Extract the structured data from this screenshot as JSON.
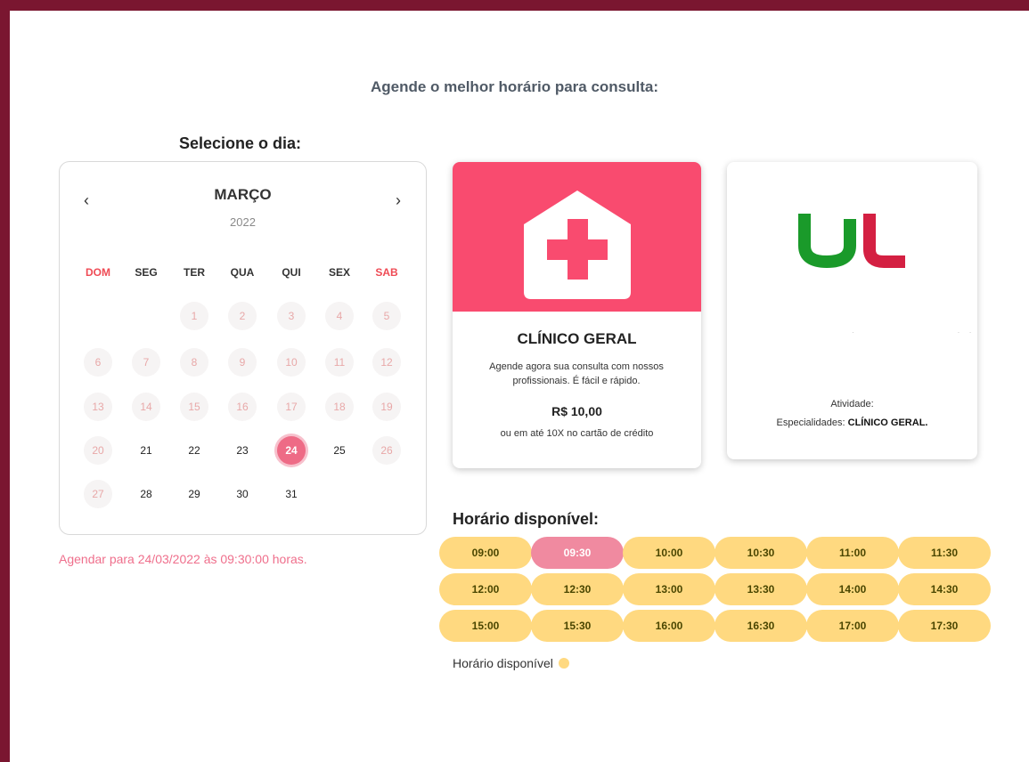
{
  "page": {
    "title": "Agende o melhor horário para consulta:"
  },
  "calendar": {
    "section_title": "Selecione o dia:",
    "month": "MARÇO",
    "year": "2022",
    "prev_icon": "chevron-left-icon",
    "next_icon": "chevron-right-icon",
    "prev_symbol": "‹",
    "next_symbol": "›",
    "weekdays": [
      "DOM",
      "SEG",
      "TER",
      "QUA",
      "QUI",
      "SEX",
      "SAB"
    ],
    "first_weekday_index": 2,
    "days_in_month": 31,
    "available_days": [
      21,
      22,
      23,
      24,
      25,
      28,
      29,
      30,
      31
    ],
    "selected_day": 24
  },
  "schedule_message": "Agendar para 24/03/2022 às 09:30:00 horas.",
  "service_card": {
    "icon": "hospital-house-icon",
    "title": "CLÍNICO GERAL",
    "description": "Agende agora sua consulta com nossos profissionais. É fácil e rápido.",
    "price": "R$ 10,00",
    "installments": "ou em até 10X no cartão de crédito"
  },
  "doctor_card": {
    "logo": "ul-logo",
    "activity": "Atividade:",
    "specialties_label": "Especialidades:",
    "specialties_value": "CLÍNICO GERAL."
  },
  "times": {
    "section_title": "Horário disponível:",
    "slots": [
      "09:00",
      "09:30",
      "10:00",
      "10:30",
      "11:00",
      "11:30",
      "12:00",
      "12:30",
      "13:00",
      "13:30",
      "14:00",
      "14:30",
      "15:00",
      "15:30",
      "16:00",
      "16:30",
      "17:00",
      "17:30"
    ],
    "selected": "09:30",
    "legend": "Horário disponível"
  },
  "colors": {
    "frame": "#7a1630",
    "accent_pink": "#f94b6f",
    "selected_pink": "#ee6b86",
    "slot_yellow": "#ffd980",
    "weekend_red": "#ef4b55",
    "logo_green": "#1a9a2a",
    "logo_red": "#d42042"
  }
}
